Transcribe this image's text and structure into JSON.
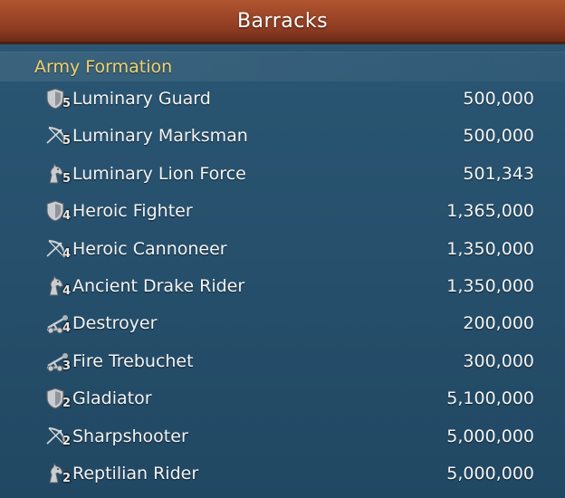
{
  "window": {
    "title": "Barracks"
  },
  "section": {
    "title": "Army Formation"
  },
  "units": [
    {
      "icon": "shield-icon",
      "tier": "5",
      "name": "Luminary Guard",
      "count": "500,000"
    },
    {
      "icon": "bow-icon",
      "tier": "5",
      "name": "Luminary Marksman",
      "count": "500,000"
    },
    {
      "icon": "horse-icon",
      "tier": "5",
      "name": "Luminary Lion Force",
      "count": "501,343"
    },
    {
      "icon": "shield-icon",
      "tier": "4",
      "name": "Heroic Fighter",
      "count": "1,365,000"
    },
    {
      "icon": "bow-icon",
      "tier": "4",
      "name": "Heroic Cannoneer",
      "count": "1,350,000"
    },
    {
      "icon": "horse-icon",
      "tier": "4",
      "name": "Ancient Drake Rider",
      "count": "1,350,000"
    },
    {
      "icon": "catapult-icon",
      "tier": "4",
      "name": "Destroyer",
      "count": "200,000"
    },
    {
      "icon": "catapult-icon",
      "tier": "3",
      "name": "Fire Trebuchet",
      "count": "300,000"
    },
    {
      "icon": "shield-icon",
      "tier": "2",
      "name": "Gladiator",
      "count": "5,100,000"
    },
    {
      "icon": "bow-icon",
      "tier": "2",
      "name": "Sharpshooter",
      "count": "5,000,000"
    },
    {
      "icon": "horse-icon",
      "tier": "2",
      "name": "Reptilian Rider",
      "count": "5,000,000"
    }
  ]
}
